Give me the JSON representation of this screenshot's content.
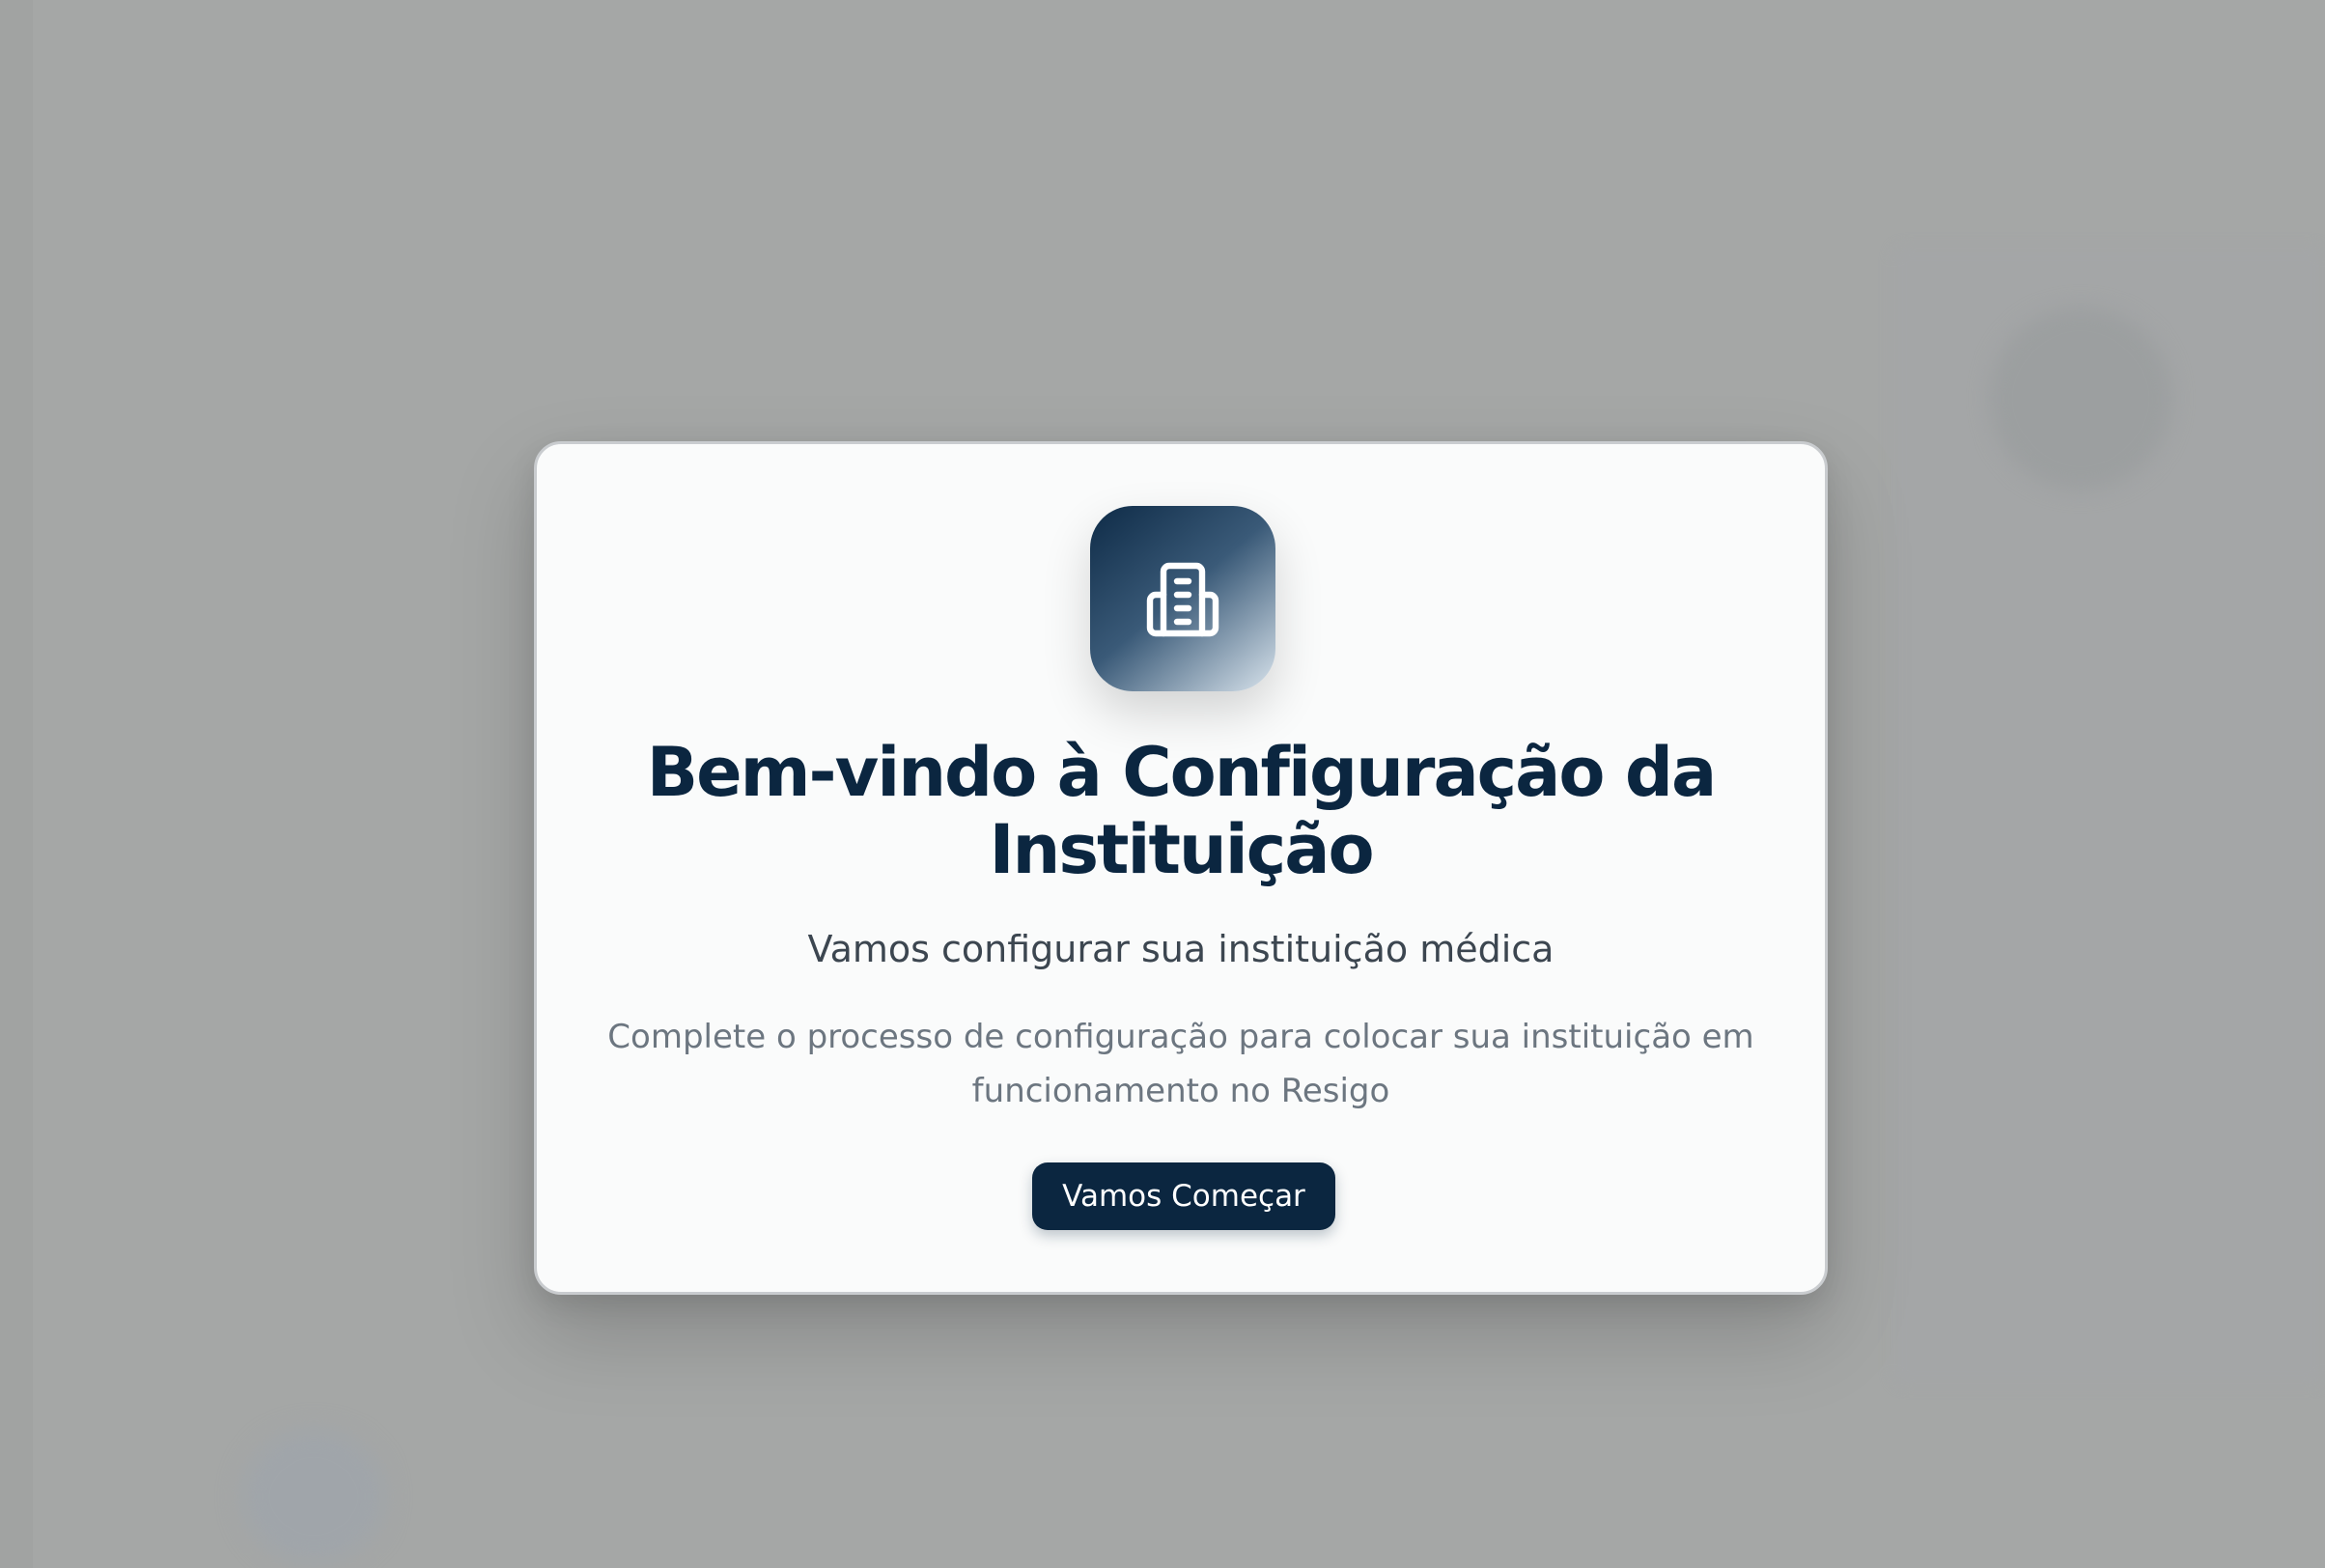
{
  "modal": {
    "icon": "building-icon",
    "title": "Bem-vindo à Configuração da Instituição",
    "subtitle": "Vamos configurar sua instituição médica",
    "description": "Complete o processo de configuração para colocar sua instituição em funcionamento no Resigo",
    "cta_label": "Vamos Começar"
  },
  "colors": {
    "overlay": "#a5a7a6",
    "modal_background": "#fafbfb",
    "primary": "#0b2640",
    "subtitle_text": "#3c4650",
    "description_text": "#6c7680"
  }
}
